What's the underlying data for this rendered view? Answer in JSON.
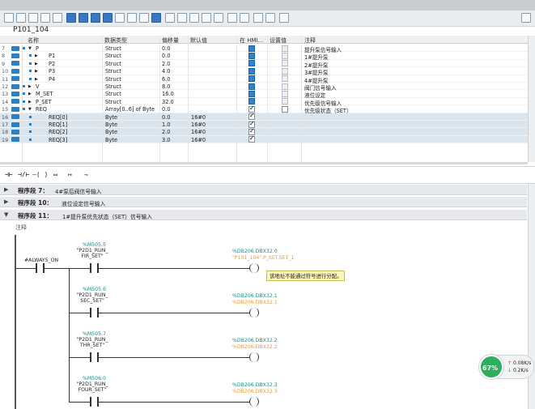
{
  "block_name": "P101_104",
  "columns": [
    "名称",
    "数据类型",
    "偏移量",
    "默认值",
    "在 HMI...",
    "设置值",
    "注释"
  ],
  "rows": [
    {
      "num": "7",
      "name": "P",
      "type": "Struct",
      "offset": "0.0",
      "default": "",
      "comment": "提升泵信号输入",
      "hmi": "on",
      "setv": "off",
      "sel": false,
      "indent": 0,
      "expand": "▼"
    },
    {
      "num": "8",
      "name": "P1",
      "type": "Struct",
      "offset": "0.0",
      "default": "",
      "comment": "1#提升泵",
      "hmi": "on",
      "setv": "off",
      "sel": false,
      "indent": 1,
      "expand": "▶"
    },
    {
      "num": "9",
      "name": "P2",
      "type": "Struct",
      "offset": "2.0",
      "default": "",
      "comment": "2#提升泵",
      "hmi": "on",
      "setv": "off",
      "sel": false,
      "indent": 1,
      "expand": "▶"
    },
    {
      "num": "10",
      "name": "P3",
      "type": "Struct",
      "offset": "4.0",
      "default": "",
      "comment": "3#提升泵",
      "hmi": "on",
      "setv": "off",
      "sel": false,
      "indent": 1,
      "expand": "▶"
    },
    {
      "num": "11",
      "name": "P4",
      "type": "Struct",
      "offset": "6.0",
      "default": "",
      "comment": "4#提升泵",
      "hmi": "on",
      "setv": "off",
      "sel": false,
      "indent": 1,
      "expand": "▶"
    },
    {
      "num": "12",
      "name": "V",
      "type": "Struct",
      "offset": "8.0",
      "default": "",
      "comment": "阀门信号输入",
      "hmi": "on",
      "setv": "off",
      "sel": false,
      "indent": 0,
      "expand": "▶"
    },
    {
      "num": "13",
      "name": "M_SET",
      "type": "Struct",
      "offset": "16.0",
      "default": "",
      "comment": "液位设定",
      "hmi": "on",
      "setv": "off",
      "sel": false,
      "indent": 0,
      "expand": "▶"
    },
    {
      "num": "14",
      "name": "P_SET",
      "type": "Struct",
      "offset": "32.0",
      "default": "",
      "comment": "优先级信号输入",
      "hmi": "on",
      "setv": "off",
      "sel": false,
      "indent": 0,
      "expand": "▶"
    },
    {
      "num": "15",
      "name": "REQ",
      "type": "Array[0..6] of Byte",
      "offset": "0.0",
      "default": "",
      "comment": "优先级状态（SET）",
      "hmi": "tick",
      "setv": "white",
      "sel": false,
      "indent": 0,
      "expand": "▼"
    },
    {
      "num": "16",
      "name": "REQ[0]",
      "type": "Byte",
      "offset": "0.0",
      "default": "16#0",
      "comment": "",
      "hmi": "tick",
      "setv": "none",
      "sel": true,
      "indent": 1,
      "expand": ""
    },
    {
      "num": "17",
      "name": "REQ[1]",
      "type": "Byte",
      "offset": "1.0",
      "default": "16#0",
      "comment": "",
      "hmi": "tick",
      "setv": "none",
      "sel": true,
      "indent": 1,
      "expand": ""
    },
    {
      "num": "18",
      "name": "REQ[2]",
      "type": "Byte",
      "offset": "2.0",
      "default": "16#0",
      "comment": "",
      "hmi": "tick",
      "setv": "none",
      "sel": true,
      "indent": 1,
      "expand": ""
    },
    {
      "num": "19",
      "name": "REQ[3]",
      "type": "Byte",
      "offset": "3.0",
      "default": "16#0",
      "comment": "",
      "hmi": "tick",
      "setv": "none",
      "sel": true,
      "indent": 1,
      "expand": ""
    }
  ],
  "ladder_icons": [
    "⊣⊢",
    "⊣/⊢",
    "–( )",
    "▭",
    "↦",
    "⇁"
  ],
  "networks": [
    {
      "arrow": "▶",
      "title": "程序段 7：",
      "comment": "4#泵后阀信号输入"
    },
    {
      "arrow": "▶",
      "title": "程序段 10：",
      "comment": "液位设定信号输入"
    },
    {
      "arrow": "▼",
      "title": "程序段 11：",
      "comment": "1#提升泵优先状态（SET）信号输入"
    }
  ],
  "comment_label": "注释",
  "ladder": {
    "always_on": "#ALWAYS_ON",
    "contacts": [
      {
        "addr": "%M505.5",
        "name": "\"P2D1_RUN_ FIR_SET\"",
        "coil_addr": "%DB206.DBX32.0",
        "coil_name": "\"P101_104\".P_SET.SET_1"
      },
      {
        "addr": "%M505.6",
        "name": "\"P2D1_RUN_ SEC_SET\"",
        "coil_addr": "%DB206.DBX32.1",
        "coil_name": "%DB206.DBX32.1"
      },
      {
        "addr": "%M505.7",
        "name": "\"P2D1_RUN_ THR_SET\"",
        "coil_addr": "%DB206.DBX32.2",
        "coil_name": "%DB206.DBX32.2"
      },
      {
        "addr": "%M506.0",
        "name": "\"P2D1_RUN_ FOUR_SET\"",
        "coil_addr": "%DB206.DBX32.3",
        "coil_name": "%DB206.DBX32.3"
      }
    ],
    "tooltip": "该地址不能通过符号进行分配。"
  },
  "net_widget": {
    "percent": "67%",
    "up": "0.08K/s",
    "down": "0.2K/s"
  }
}
